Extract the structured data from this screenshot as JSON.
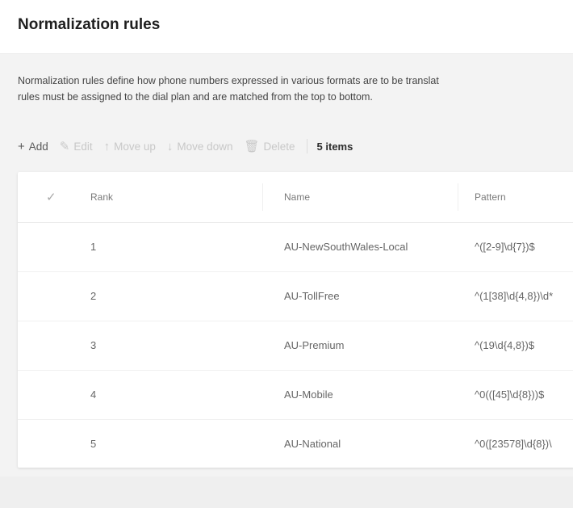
{
  "page": {
    "title": "Normalization rules"
  },
  "description": {
    "line1": "Normalization rules define how phone numbers expressed in various formats are to be translat",
    "line2": "rules must be assigned to the dial plan and are matched from the top to bottom."
  },
  "toolbar": {
    "add": {
      "label": "Add",
      "icon": "plus-icon"
    },
    "edit": {
      "label": "Edit",
      "icon": "pencil-icon"
    },
    "move_up": {
      "label": "Move up",
      "icon": "arrow-up-icon"
    },
    "move_down": {
      "label": "Move down",
      "icon": "arrow-down-icon"
    },
    "delete": {
      "label": "Delete",
      "icon": "trash-icon"
    },
    "count": "5 items"
  },
  "table": {
    "columns": {
      "rank": "Rank",
      "name": "Name",
      "pattern": "Pattern"
    },
    "rows": [
      {
        "rank": "1",
        "name": "AU-NewSouthWales-Local",
        "pattern": "^([2-9]\\d{7})$"
      },
      {
        "rank": "2",
        "name": "AU-TollFree",
        "pattern": "^(1[38]\\d{4,8})\\d*"
      },
      {
        "rank": "3",
        "name": "AU-Premium",
        "pattern": "^(19\\d{4,8})$"
      },
      {
        "rank": "4",
        "name": "AU-Mobile",
        "pattern": "^0(([45]\\d{8}))$"
      },
      {
        "rank": "5",
        "name": "AU-National",
        "pattern": "^0([23578]\\d{8})\\"
      }
    ]
  },
  "colors": {
    "accent": "#6264a7",
    "text": "#252423",
    "muted": "#666666"
  }
}
